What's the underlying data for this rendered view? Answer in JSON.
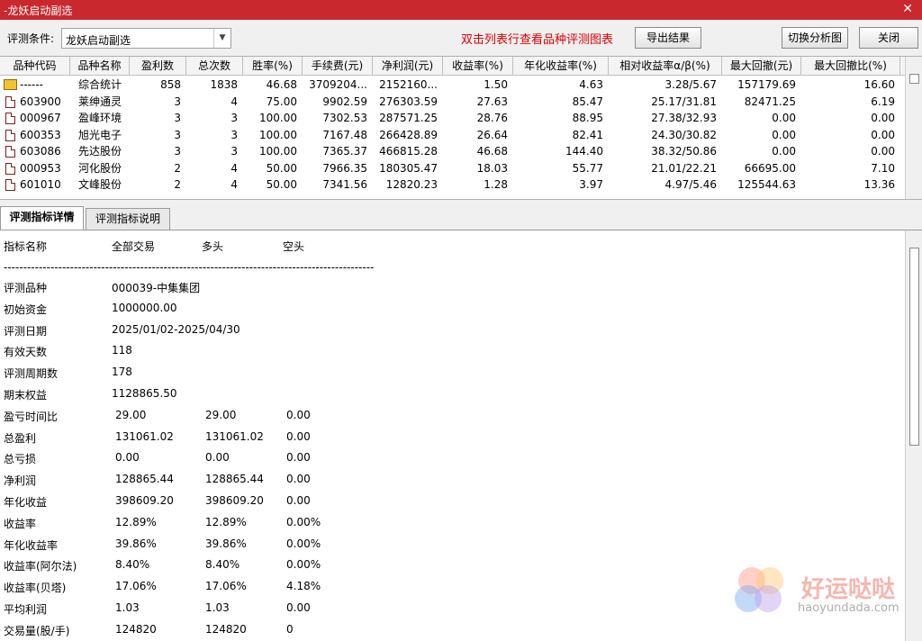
{
  "window": {
    "title": "-龙妖启动副选",
    "close": "✕"
  },
  "toolbar": {
    "cond_label": "评测条件:",
    "cond_value": "龙妖启动副选",
    "hint": "双击列表行查看品种评测图表",
    "export_label": "导出结果",
    "switch_label": "切换分析图",
    "close_label": "关闭"
  },
  "grid": {
    "columns": [
      "品种代码",
      "品种名称",
      "盈利数",
      "总次数",
      "胜率(%)",
      "手续费(元)",
      "净利润(元)",
      "收益率(%)",
      "年化收益率(%)",
      "相对收益率α/β(%)",
      "最大回撤(元)",
      "最大回撤比(%)"
    ],
    "rows": [
      {
        "code": "------",
        "name": "综合统计",
        "win": "858",
        "total": "1838",
        "rate": "46.68",
        "fee": "3709204...",
        "profit": "2152160...",
        "ret": "1.50",
        "ann": "4.63",
        "rel": "3.28/5.67",
        "dd": "157179.69",
        "ddr": "16.60"
      },
      {
        "code": "603900",
        "name": "莱绅通灵",
        "win": "3",
        "total": "4",
        "rate": "75.00",
        "fee": "9902.59",
        "profit": "276303.59",
        "ret": "27.63",
        "ann": "85.47",
        "rel": "25.17/31.81",
        "dd": "82471.25",
        "ddr": "6.19"
      },
      {
        "code": "000967",
        "name": "盈峰环境",
        "win": "3",
        "total": "3",
        "rate": "100.00",
        "fee": "7302.53",
        "profit": "287571.25",
        "ret": "28.76",
        "ann": "88.95",
        "rel": "27.38/32.93",
        "dd": "0.00",
        "ddr": "0.00"
      },
      {
        "code": "600353",
        "name": "旭光电子",
        "win": "3",
        "total": "3",
        "rate": "100.00",
        "fee": "7167.48",
        "profit": "266428.89",
        "ret": "26.64",
        "ann": "82.41",
        "rel": "24.30/30.82",
        "dd": "0.00",
        "ddr": "0.00"
      },
      {
        "code": "603086",
        "name": "先达股份",
        "win": "3",
        "total": "3",
        "rate": "100.00",
        "fee": "7365.37",
        "profit": "466815.28",
        "ret": "46.68",
        "ann": "144.40",
        "rel": "38.32/50.86",
        "dd": "0.00",
        "ddr": "0.00"
      },
      {
        "code": "000953",
        "name": "河化股份",
        "win": "2",
        "total": "4",
        "rate": "50.00",
        "fee": "7966.35",
        "profit": "180305.47",
        "ret": "18.03",
        "ann": "55.77",
        "rel": "21.01/22.21",
        "dd": "66695.00",
        "ddr": "7.10"
      },
      {
        "code": "601010",
        "name": "文峰股份",
        "win": "2",
        "total": "4",
        "rate": "50.00",
        "fee": "7341.56",
        "profit": "12820.23",
        "ret": "1.28",
        "ann": "3.97",
        "rel": "4.97/5.46",
        "dd": "125544.63",
        "ddr": "13.36"
      }
    ]
  },
  "tabs": {
    "details": "评测指标详情",
    "explain": "评测指标说明"
  },
  "detail": {
    "headers": {
      "name": "指标名称",
      "all": "全部交易",
      "long": "多头",
      "short": "空头"
    },
    "separator": "-----------------------------------------------------------------------------------------------",
    "lines": [
      {
        "label": "评测品种",
        "a": "000039-中集集团",
        "b": "",
        "c": ""
      },
      {
        "label": "初始资金",
        "a": "1000000.00",
        "b": "",
        "c": ""
      },
      {
        "label": "评测日期",
        "a": "2025/01/02-2025/04/30",
        "b": "",
        "c": ""
      },
      {
        "label": "有效天数",
        "a": "118",
        "b": "",
        "c": ""
      },
      {
        "label": "评测周期数",
        "a": "178",
        "b": "",
        "c": ""
      },
      {
        "label": "期末权益",
        "a": "1128865.50",
        "b": "",
        "c": ""
      },
      {
        "label": "盈亏时间比",
        "a": "29.00",
        "b": "29.00",
        "c": "0.00"
      },
      {
        "label": "总盈利",
        "a": "131061.02",
        "b": "131061.02",
        "c": "0.00"
      },
      {
        "label": "总亏损",
        "a": "0.00",
        "b": "0.00",
        "c": "0.00"
      },
      {
        "label": "净利润",
        "a": "128865.44",
        "b": "128865.44",
        "c": "0.00"
      },
      {
        "label": "年化收益",
        "a": "398609.20",
        "b": "398609.20",
        "c": "0.00"
      },
      {
        "label": "收益率",
        "a": "12.89%",
        "b": "12.89%",
        "c": "0.00%"
      },
      {
        "label": "年化收益率",
        "a": "39.86%",
        "b": "39.86%",
        "c": "0.00%"
      },
      {
        "label": "收益率(阿尔法)",
        "a": "8.40%",
        "b": "8.40%",
        "c": "0.00%"
      },
      {
        "label": "收益率(贝塔)",
        "a": "17.06%",
        "b": "17.06%",
        "c": "4.18%"
      },
      {
        "label": "平均利润",
        "a": "1.03",
        "b": "1.03",
        "c": "0.00"
      },
      {
        "label": "交易量(股/手)",
        "a": "124820",
        "b": "124820",
        "c": "0"
      }
    ]
  },
  "watermark": {
    "cn": "好运哒哒",
    "en": "haoyundada.com"
  }
}
